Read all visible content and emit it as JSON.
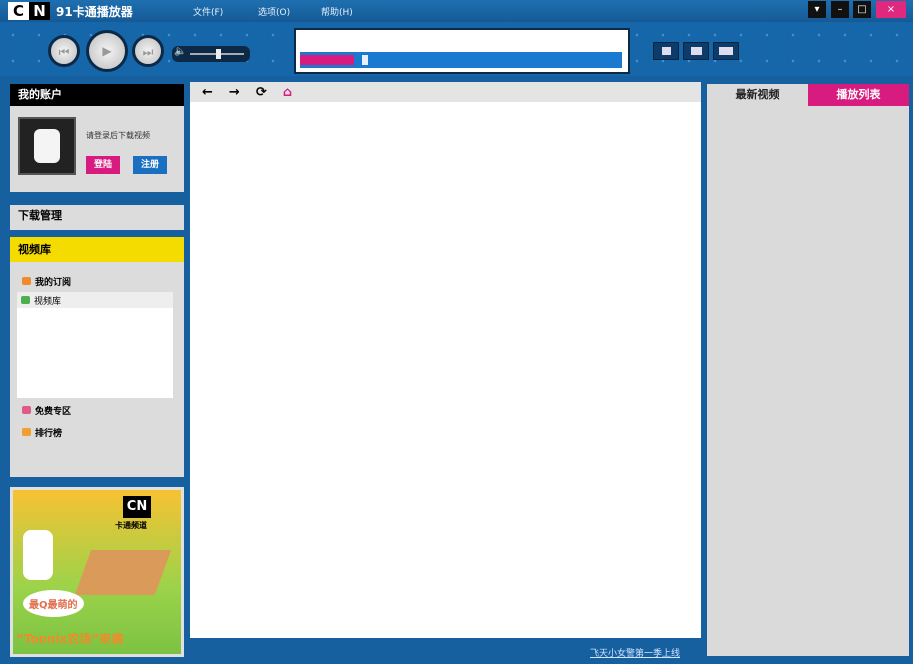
{
  "app": {
    "logo": "CN",
    "title": "91卡通播放器"
  },
  "menu": [
    {
      "label": "文件(F)"
    },
    {
      "label": "选项(O)"
    },
    {
      "label": "帮助(H)"
    }
  ],
  "window_buttons": {
    "dropdown": "▾",
    "minimize": "–",
    "maximize": "□",
    "close": "×"
  },
  "player": {
    "prev": "⏮",
    "play": "▶",
    "next": "⏭",
    "volume_icon": "🔈",
    "progress_percent": 3,
    "volume_level": 0.5
  },
  "view_buttons": [
    "single",
    "double",
    "triple"
  ],
  "account": {
    "header": "我的账户",
    "prompt": "请登录后下载视频",
    "login": "登陆",
    "register": "注册"
  },
  "download": {
    "header": "下载管理"
  },
  "library": {
    "header": "视频库",
    "items": [
      {
        "label": "我的订阅",
        "color": "#f08a2c"
      },
      {
        "label": "视频库",
        "color": "#4caf50"
      },
      {
        "label": "免费专区",
        "color": "#e05a8a"
      },
      {
        "label": "排行榜",
        "color": "#f0a030"
      }
    ]
  },
  "ad": {
    "logo": "CN",
    "brand": "卡通频道",
    "slogan": "最Q最萌的",
    "headline": "“Toonix农场”来袭"
  },
  "nav": {
    "back": "←",
    "forward": "→",
    "refresh": "⟳",
    "home": "⌂"
  },
  "footer": {
    "link": "飞天小女警第一季上线"
  },
  "right_tabs": [
    {
      "label": "最新视频"
    },
    {
      "label": "播放列表"
    }
  ],
  "colors": {
    "accent": "#d81b7f",
    "frame": "#17609f",
    "library": "#f5dc00"
  }
}
